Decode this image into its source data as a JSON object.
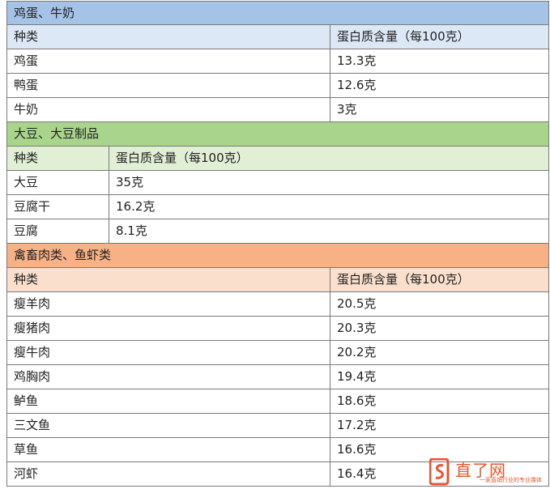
{
  "sections": [
    {
      "title": "鸡蛋、牛奶",
      "col1_header": "种类",
      "col2_header": "蛋白质含量（每100克）",
      "rows": [
        {
          "name": "鸡蛋",
          "value": "13.3克"
        },
        {
          "name": "鸭蛋",
          "value": "12.6克"
        },
        {
          "name": "牛奶",
          "value": "3克"
        }
      ]
    },
    {
      "title": "大豆、大豆制品",
      "col1_header": "种类",
      "col2_header": "蛋白质含量（每100克）",
      "rows": [
        {
          "name": "大豆",
          "value": "35克"
        },
        {
          "name": "豆腐干",
          "value": "16.2克"
        },
        {
          "name": "豆腐",
          "value": "8.1克"
        }
      ]
    },
    {
      "title": "禽畜肉类、鱼虾类",
      "col1_header": "种类",
      "col2_header": "蛋白质含量（每100克）",
      "rows": [
        {
          "name": "瘦羊肉",
          "value": "20.5克"
        },
        {
          "name": "瘦猪肉",
          "value": "20.3克"
        },
        {
          "name": "瘦牛肉",
          "value": "20.2克"
        },
        {
          "name": "鸡胸肉",
          "value": "19.4克"
        },
        {
          "name": "鲈鱼",
          "value": "18.6克"
        },
        {
          "name": "三文鱼",
          "value": "17.2克"
        },
        {
          "name": "草鱼",
          "value": "16.6克"
        },
        {
          "name": "河虾",
          "value": "16.4克"
        }
      ]
    }
  ],
  "watermark": {
    "name": "直了网",
    "slogan": "一家直销行业的专业媒体"
  },
  "colors": {
    "section_blue": "#a4c3e7",
    "section_green": "#a8d58b",
    "section_orange": "#f6b185",
    "header_blue": "#dce8f5",
    "header_green": "#e1efd5",
    "header_orange": "#fadfcd",
    "watermark": "#e8542f"
  }
}
